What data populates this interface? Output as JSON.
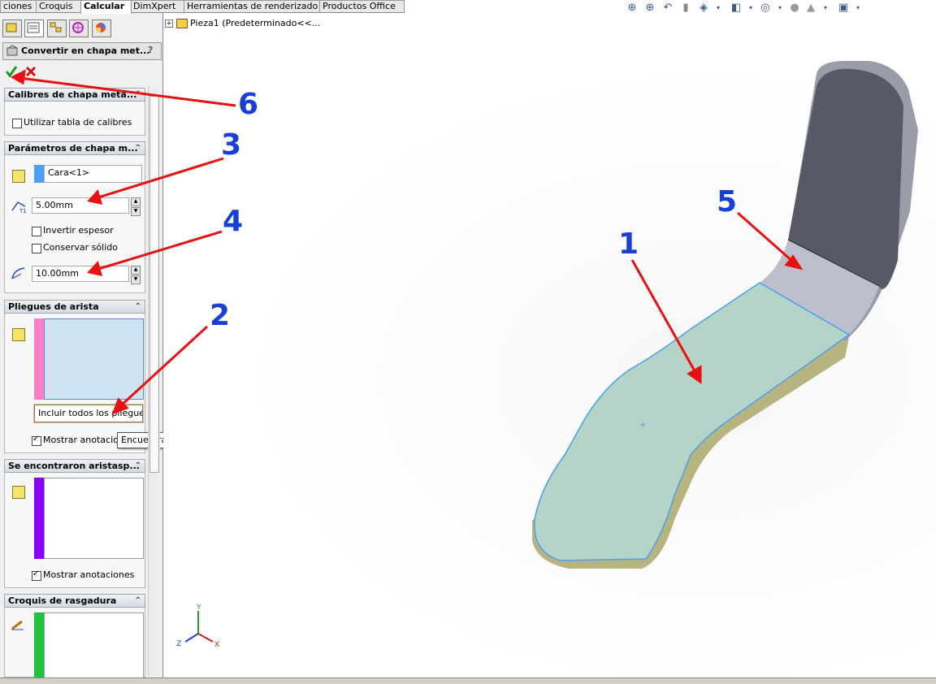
{
  "tabs": [
    "ciones",
    "Croquis",
    "Calcular",
    "DimXpert",
    "Herramientas de renderizado",
    "Productos Office"
  ],
  "active_tab": "Calcular",
  "panel_title": "Convertir en chapa met...",
  "panel_help": "?",
  "sections": {
    "calibres": {
      "header": "Calibres de chapa metá...",
      "checkbox_label": "Utilizar tabla de calibres",
      "checked": false
    },
    "parametros": {
      "header": "Parámetros de chapa m...",
      "face_value": "Cara<1>",
      "thickness_value": "5.00mm",
      "invert_label": "Invertir espesor",
      "invert_checked": false,
      "keep_solid_label": "Conservar sólido",
      "keep_solid_checked": false,
      "radius_value": "10.00mm"
    },
    "pliegues": {
      "header": "Pliegues de arista",
      "button_label": "Incluir todos los pliegues",
      "show_label": "Mostrar anotaciones",
      "show_checked": true
    },
    "aristas": {
      "header": "Se encontraron aristasp...",
      "show_label": "Mostrar anotaciones",
      "show_checked": true
    },
    "rasgadura": {
      "header": "Croquis de rasgadura"
    }
  },
  "tooltip": "Encuentra todos los pliegues ya hechos y el grosor de la pieza",
  "tree_item": "Pieza1  (Predeterminado<<...",
  "callouts": [
    "1",
    "2",
    "3",
    "4",
    "5",
    "6"
  ],
  "axes": {
    "x": "X",
    "y": "Y",
    "z": "Z"
  },
  "colors": {
    "callout": "#1a3fd6",
    "arrow": "#e81010",
    "face_color_bar": "#4da0ff",
    "edge_bend_bar": "#ff7fc8",
    "found_edges_bar": "#8a00ff",
    "rip_sketch_bar": "#1ec43a",
    "selected_face": "#b3d4c6",
    "part_dark_face": "#575a66"
  }
}
